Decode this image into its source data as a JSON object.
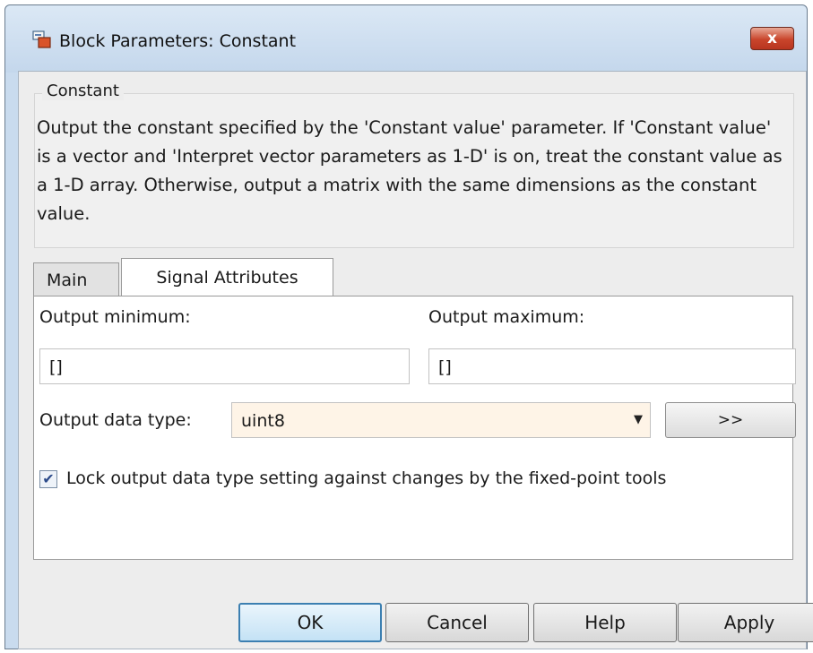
{
  "window": {
    "title": "Block Parameters: Constant",
    "close_label": "x"
  },
  "group": {
    "legend": "Constant",
    "description": "Output the constant specified by the 'Constant value' parameter. If 'Constant value' is a vector and 'Interpret vector parameters as 1-D' is on, treat the constant value as a 1-D array. Otherwise, output a matrix with the same dimensions as the constant value."
  },
  "tabs": [
    {
      "label": "Main",
      "active": false
    },
    {
      "label": "Signal Attributes",
      "active": true
    }
  ],
  "signal_attributes": {
    "output_minimum_label": "Output minimum:",
    "output_minimum_value": "[]",
    "output_maximum_label": "Output maximum:",
    "output_maximum_value": "[]",
    "data_type_label": "Output data type:",
    "data_type_value": "uint8",
    "data_type_assistant_label": ">>",
    "lock_label": "Lock output data type setting against changes by the fixed-point tools",
    "lock_checked": true
  },
  "buttons": {
    "ok": "OK",
    "cancel": "Cancel",
    "help": "Help",
    "apply": "Apply"
  },
  "colors": {
    "title_bar": "#c4d7ec",
    "close_button": "#c9452b",
    "combo_background": "#fef4e7",
    "default_button_border": "#3c7fb1"
  }
}
